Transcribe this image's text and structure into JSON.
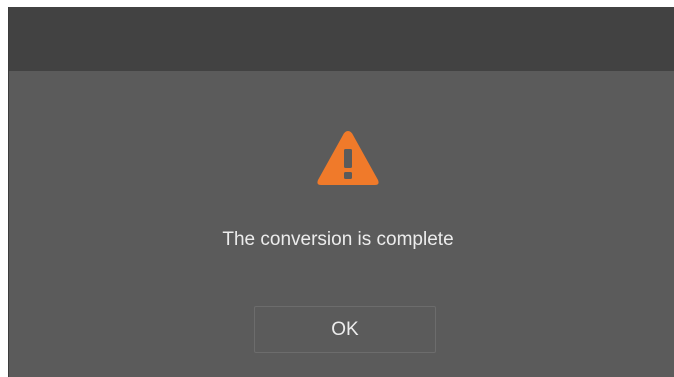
{
  "dialog": {
    "icon": "warning-icon",
    "icon_color": "#f07a2a",
    "message": "The conversion is complete",
    "ok_label": "OK"
  }
}
